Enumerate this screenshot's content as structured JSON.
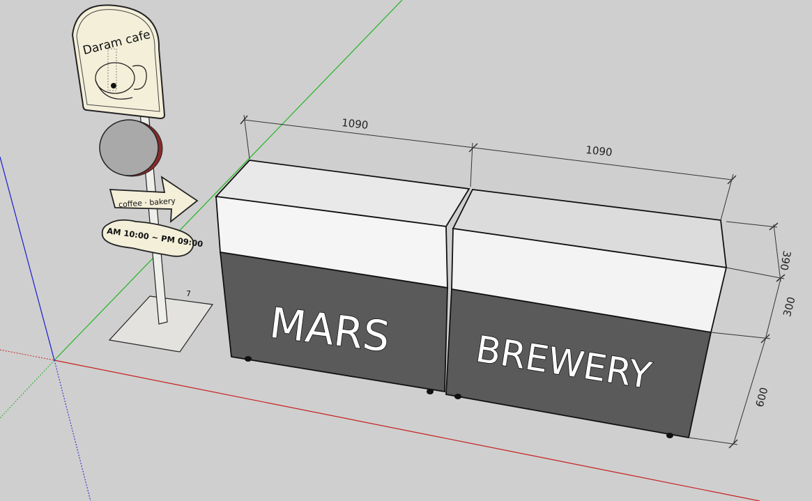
{
  "scene": {
    "background": "#cfcfcf",
    "axis_colors": {
      "red": "#c81e1e",
      "green": "#1fb51f",
      "blue": "#1a1ad2"
    },
    "signpost": {
      "cafe_name": "Daram cafe",
      "arrow_text": "coffee · bakery",
      "hours_text": "AM 10:00 ~ PM 09:00",
      "small_mark": "7"
    },
    "counters": {
      "left_text": "MARS",
      "right_text": "BREWERY",
      "top_color": "#efefef",
      "bottom_color": "#5a5a5a"
    },
    "dimensions": {
      "width_left": "1090",
      "width_right": "1090",
      "depth": "390",
      "top_height": "300",
      "bottom_height": "600"
    }
  }
}
